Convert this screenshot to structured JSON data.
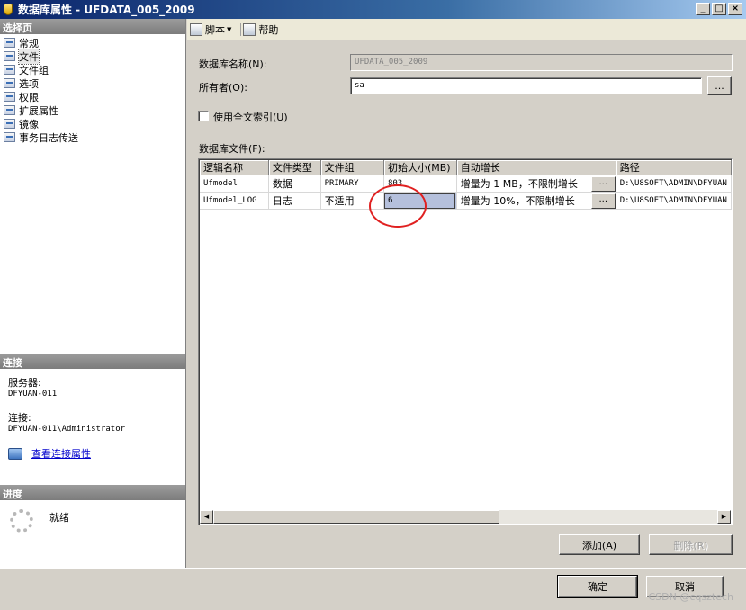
{
  "window": {
    "title": "数据库属性 - UFDATA_005_2009",
    "controls": {
      "minimize": "_",
      "maximize": "□",
      "close": "×"
    }
  },
  "left_pane": {
    "select_page_header": "选择页",
    "pages": [
      {
        "label": "常规",
        "selected": false
      },
      {
        "label": "文件",
        "selected": true
      },
      {
        "label": "文件组",
        "selected": false
      },
      {
        "label": "选项",
        "selected": false
      },
      {
        "label": "权限",
        "selected": false
      },
      {
        "label": "扩展属性",
        "selected": false
      },
      {
        "label": "镜像",
        "selected": false
      },
      {
        "label": "事务日志传送",
        "selected": false
      }
    ],
    "connection": {
      "header": "连接",
      "server_label": "服务器:",
      "server_value": "DFYUAN-011",
      "connection_label": "连接:",
      "connection_value": "DFYUAN-011\\Administrator",
      "view_properties_link": "查看连接属性"
    },
    "progress": {
      "header": "进度",
      "status": "就绪"
    }
  },
  "toolbar": {
    "script_label": "脚本",
    "script_dropdown_arrow": "▼",
    "help_label": "帮助"
  },
  "form": {
    "db_name_label": "数据库名称(N):",
    "db_name_value": "UFDATA_005_2009",
    "owner_label": "所有者(O):",
    "owner_value": "sa",
    "owner_browse": "...",
    "fulltext_label": "使用全文索引(U)",
    "fulltext_checked": false,
    "db_files_label": "数据库文件(F):"
  },
  "files_grid": {
    "columns": [
      "逻辑名称",
      "文件类型",
      "文件组",
      "初始大小(MB)",
      "自动增长",
      "路径"
    ],
    "rows": [
      [
        "Ufmodel",
        "数据",
        "PRIMARY",
        "803",
        "增量为 1 MB，不限制增长",
        "D:\\U8SOFT\\ADMIN\\DFYUAN"
      ],
      [
        "Ufmodel_LOG",
        "日志",
        "不适用",
        "6",
        "增量为 10%，不限制增长",
        "D:\\U8SOFT\\ADMIN\\DFYUAN"
      ]
    ],
    "ellipsis": "...",
    "scroll_left": "◀",
    "scroll_right": "▶"
  },
  "buttons": {
    "add": "添加(A)",
    "remove": "删除(R)",
    "ok": "确定",
    "cancel": "取消"
  },
  "watermark": "CSDN @cqsztech",
  "colors": {
    "annotation_circle": "#e02020",
    "title_gradient_start": "#0a246a",
    "link": "#0000cc"
  }
}
